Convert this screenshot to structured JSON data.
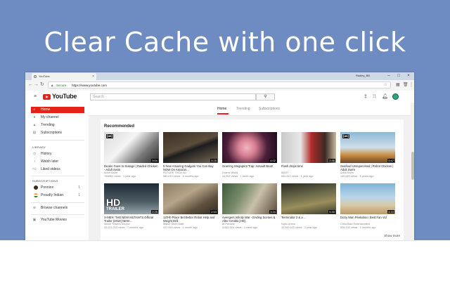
{
  "banner": {
    "title": "Clear Cache with one click"
  },
  "browser": {
    "tab_title": "YouTube",
    "profile": "Radley_Bill",
    "window_controls": [
      "–",
      "□",
      "×"
    ],
    "address": {
      "secure_label": "Secure",
      "url": "https://www.youtube.com"
    }
  },
  "youtube": {
    "logo_text": "YouTube",
    "search_placeholder": "Search",
    "tabs": [
      "Home",
      "Trending",
      "Subscriptions"
    ],
    "sidebar": {
      "main": [
        {
          "label": "Home",
          "icon": "home-icon"
        },
        {
          "label": "My channel",
          "icon": "person-icon"
        },
        {
          "label": "Trending",
          "icon": "flame-icon"
        },
        {
          "label": "Subscriptions",
          "icon": "subscriptions-icon"
        }
      ],
      "library_heading": "LIBRARY",
      "library": [
        {
          "label": "History",
          "icon": "history-icon"
        },
        {
          "label": "Watch later",
          "icon": "clock-icon"
        },
        {
          "label": "Liked videos",
          "icon": "thumb-up-icon"
        }
      ],
      "subscriptions_heading": "SUBSCRIPTIONS",
      "subscriptions": [
        {
          "label": "Ponniox",
          "count": "1",
          "color": "#3a2b1f"
        },
        {
          "label": "Proudly Indian",
          "count": "1",
          "color": "#ff9933"
        }
      ],
      "browse": "Browse channels",
      "movies": "YouTube Movies"
    },
    "section_title": "Recommended",
    "show_more": "Show more",
    "videos": [
      {
        "title": "Dealer Goes to Suitage | Raided Chicken - Adult Swim",
        "channel": "Adult Swim",
        "meta": "764K61 views · 1 year ago",
        "duration": "3:04",
        "badge": "[as]"
      },
      {
        "title": "5 New Amazing Gadgets You Can Buy NOW On Amazon...",
        "channel": "FUTURE TECH 4U",
        "meta": "580,610 views · 8 months ago",
        "duration": "5:25",
        "badge": ""
      },
      {
        "title": "Grammy Megaprint Trap: Assault Beat!",
        "channel": "Grams World",
        "meta": "24,042 views · 1 week ago",
        "duration": "4:02",
        "badge": ""
      },
      {
        "title": "Flash drops time",
        "channel": "MAST",
        "meta": "650,022 views · 1 year ago",
        "duration": "2:46",
        "badge": ""
      },
      {
        "title": "Seafood Unsupervised | Robot Chicken | Adult Swim",
        "channel": "Adult Swim",
        "meta": "145,050 views · 6 years ago",
        "duration": "0:47",
        "badge": "[as]"
      },
      {
        "title": "X-MEN: THE NEW MUTANTS Official Trailer (2018) NEW...",
        "channel": "Movie Trailers Source",
        "meta": "34,022,203 views · 7 months ago",
        "duration": "2:25",
        "badge": "HD"
      },
      {
        "title": "120-lb Place Bet Better Robot Help and Weight Drill",
        "channel": "Maker Shed Staff",
        "meta": "417,653 views · 1 month ago",
        "duration": "2:53",
        "badge": ""
      },
      {
        "title": "Avengers Infinity War - Ending Scenes & After Credits [HD]",
        "channel": "at Preview",
        "meta": "3,062,516 views · 1 week ago",
        "duration": "3:34",
        "badge": ""
      },
      {
        "title": "Terminator 2 & a ...",
        "channel": "Nubo Arrow",
        "meta": "12,000,622 views · 1 year ago",
        "duration": "5:30",
        "badge": ""
      },
      {
        "title": "Dizzy Man Peekaboo: Best Fan Vid",
        "channel": "Chris/Slab Entertainment",
        "meta": "526,201 views · 5 months ago",
        "duration": "4:10",
        "badge": ""
      }
    ]
  },
  "colors": {
    "banner": "#6e8bc2",
    "accent": "#e62117"
  }
}
